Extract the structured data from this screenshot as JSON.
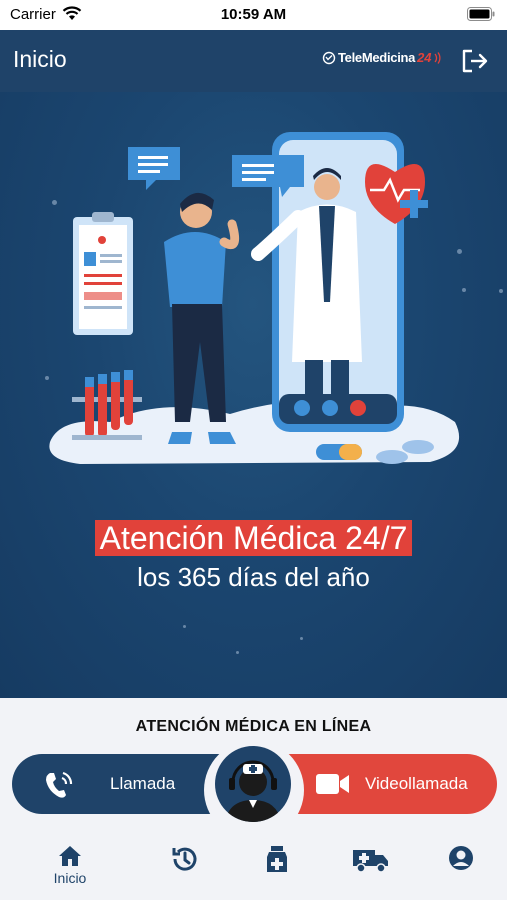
{
  "status_bar": {
    "carrier": "Carrier",
    "time": "10:59 AM"
  },
  "header": {
    "title": "Inicio",
    "logo_text": "TeleMedicina",
    "logo_number": "24"
  },
  "hero": {
    "headline": "Atención Médica 24/7",
    "subline": "los 365 días del año"
  },
  "consult": {
    "section_title": "ATENCIÓN MÉDICA EN LÍNEA",
    "call_label": "Llamada",
    "video_label": "Videollamada"
  },
  "tabs": [
    {
      "icon": "home-icon",
      "label": "Inicio",
      "active": true
    },
    {
      "icon": "history-icon",
      "label": ""
    },
    {
      "icon": "prescription-icon",
      "label": ""
    },
    {
      "icon": "ambulance-icon",
      "label": ""
    },
    {
      "icon": "profile-icon",
      "label": ""
    }
  ],
  "colors": {
    "primary": "#1f4369",
    "accent": "#e1423a",
    "background": "#f2f3f7"
  }
}
